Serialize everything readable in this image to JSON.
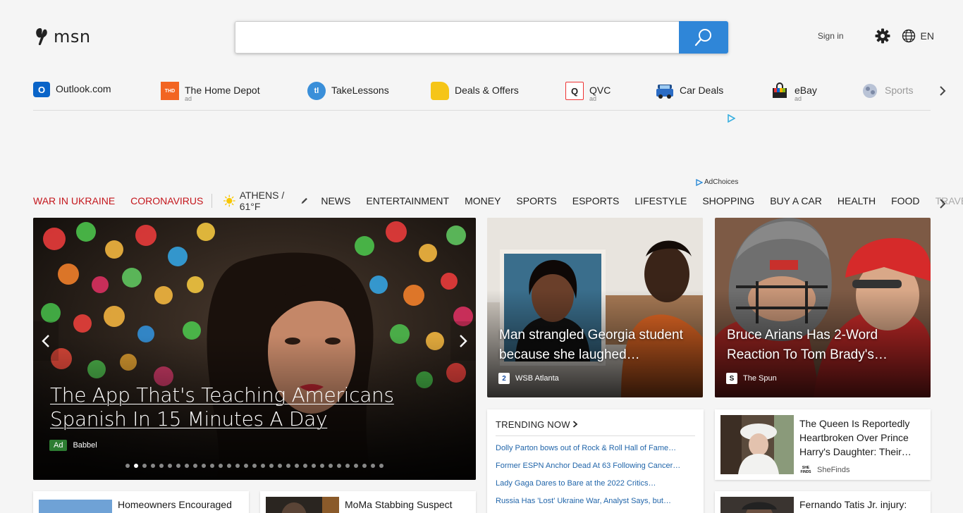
{
  "header": {
    "logo_text": "msn",
    "search_placeholder": "",
    "sign_in": "Sign in",
    "language": "EN"
  },
  "quicklinks": [
    {
      "label": "Outlook.com",
      "ad": ""
    },
    {
      "label": "The Home Depot",
      "ad": "ad"
    },
    {
      "label": "TakeLessons",
      "ad": ""
    },
    {
      "label": "Deals & Offers",
      "ad": ""
    },
    {
      "label": "QVC",
      "ad": "ad"
    },
    {
      "label": "Car Deals",
      "ad": ""
    },
    {
      "label": "eBay",
      "ad": "ad"
    },
    {
      "label": "Sports",
      "ad": ""
    }
  ],
  "adchoices": "AdChoices",
  "nav": {
    "topics": [
      "WAR IN UKRAINE",
      "CORONAVIRUS"
    ],
    "weather": "ATHENS / 61°F",
    "items": [
      "NEWS",
      "ENTERTAINMENT",
      "MONEY",
      "SPORTS",
      "ESPORTS",
      "LIFESTYLE",
      "SHOPPING",
      "BUY A CAR",
      "HEALTH",
      "FOOD",
      "TRAVEL"
    ]
  },
  "hero": {
    "title": "The App That's Teaching Americans Spanish In 15 Minutes A Day",
    "badge": "Ad",
    "source": "Babbel",
    "dots_total": 31,
    "dots_active": 1
  },
  "cards": [
    {
      "title": "Man strangled Georgia student because she laughed…",
      "source": "WSB Atlanta"
    },
    {
      "title": "Bruce Arians Has 2-Word Reaction To Tom Brady's…",
      "source": "The Spun"
    }
  ],
  "trending": {
    "heading": "TRENDING NOW",
    "items": [
      "Dolly Parton bows out of Rock & Roll Hall of Fame…",
      "Former ESPN Anchor Dead At 63 Following Cancer…",
      "Lady Gaga Dares to Bare at the 2022 Critics…",
      "Russia Has 'Lost' Ukraine War, Analyst Says, but…"
    ]
  },
  "stories": [
    {
      "title": "The Queen Is Reportedly Heartbroken Over Prince Harry's Daughter: Their…",
      "source": "SheFinds",
      "logo": "SHE FINDS"
    },
    {
      "title": "Homeowners Encouraged to",
      "source": ""
    },
    {
      "title": "MoMa Stabbing Suspect",
      "source": ""
    },
    {
      "title": "Fernando Tatis Jr. injury:",
      "source": ""
    }
  ],
  "colors": {
    "accent": "#2f86d8",
    "topic_red": "#c4161c",
    "link_blue": "#2266aa",
    "ad_green": "#2d7d32"
  }
}
